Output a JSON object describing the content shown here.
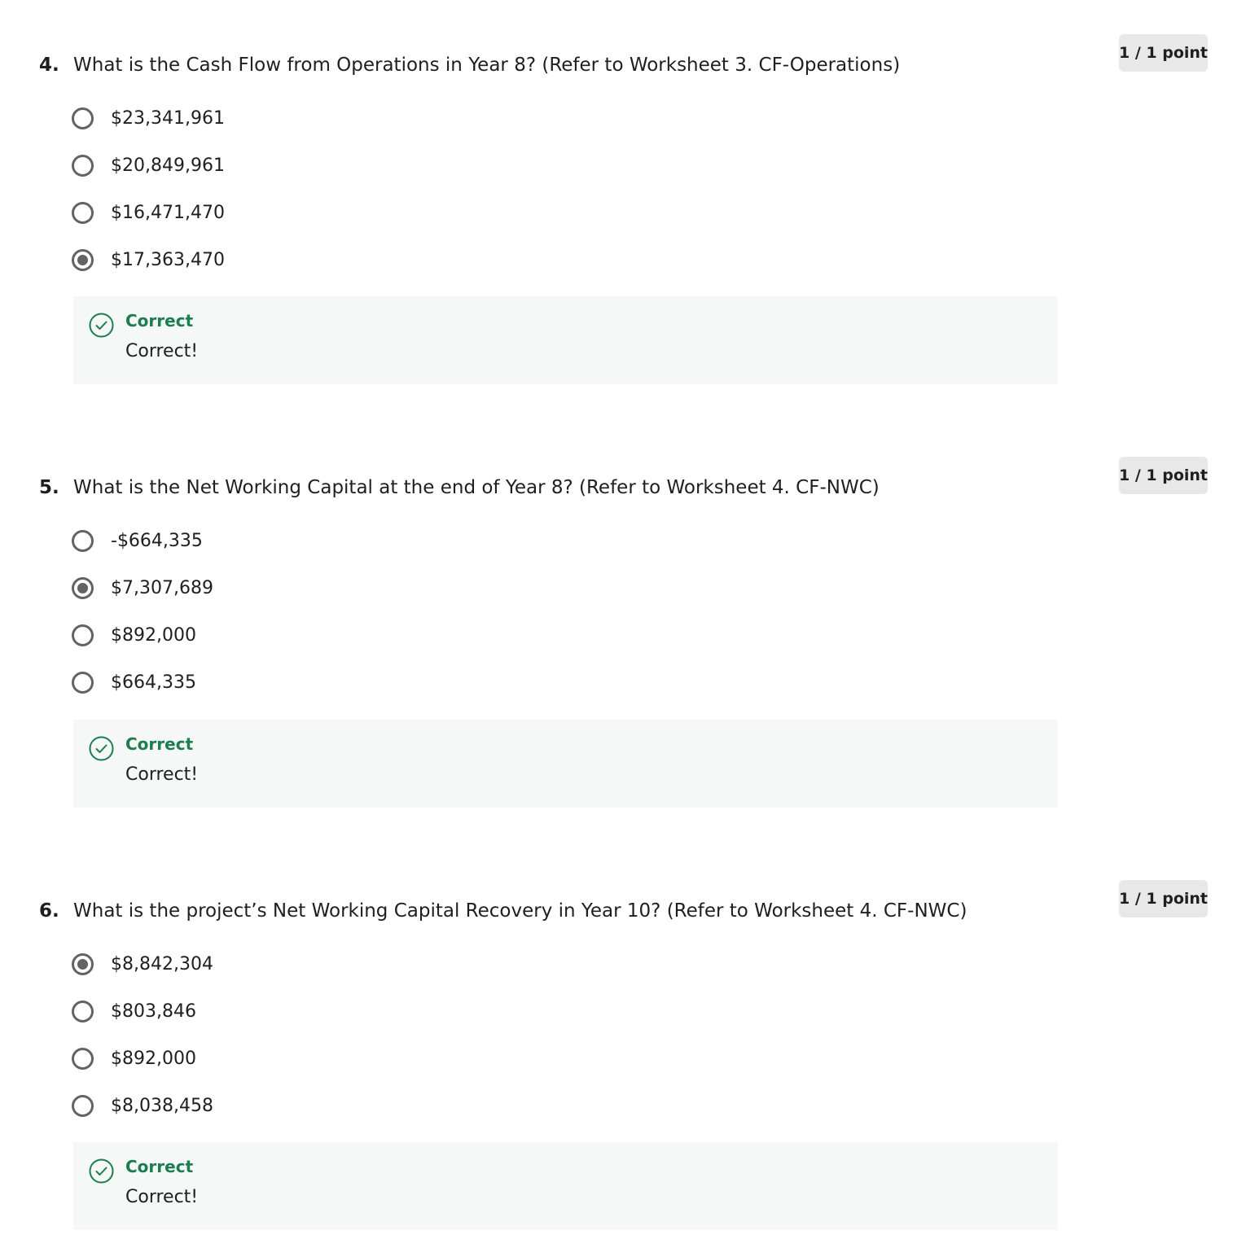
{
  "questions": [
    {
      "number": "4.",
      "text": "What is the Cash Flow from Operations in Year 8? (Refer to Worksheet 3. CF-Operations)",
      "points": "1 / 1 point",
      "options": [
        {
          "label": "$23,341,961",
          "selected": false
        },
        {
          "label": "$20,849,961",
          "selected": false
        },
        {
          "label": "$16,471,470",
          "selected": false
        },
        {
          "label": "$17,363,470",
          "selected": true
        }
      ],
      "feedback": {
        "title": "Correct",
        "text": "Correct!",
        "icon": "check-circle-icon"
      }
    },
    {
      "number": "5.",
      "text": "What is the Net Working Capital at the end of Year 8? (Refer to Worksheet 4. CF-NWC)",
      "points": "1 / 1 point",
      "options": [
        {
          "label": "-$664,335",
          "selected": false
        },
        {
          "label": "$7,307,689",
          "selected": true
        },
        {
          "label": "$892,000",
          "selected": false
        },
        {
          "label": "$664,335",
          "selected": false
        }
      ],
      "feedback": {
        "title": "Correct",
        "text": "Correct!",
        "icon": "check-circle-icon"
      }
    },
    {
      "number": "6.",
      "text": "What is the project’s Net Working Capital Recovery in Year 10? (Refer to Worksheet 4. CF-NWC)",
      "points": "1 / 1 point",
      "options": [
        {
          "label": "$8,842,304",
          "selected": true
        },
        {
          "label": "$803,846",
          "selected": false
        },
        {
          "label": "$892,000",
          "selected": false
        },
        {
          "label": "$8,038,458",
          "selected": false
        }
      ],
      "feedback": {
        "title": "Correct",
        "text": "Correct!",
        "icon": "check-circle-icon"
      }
    }
  ],
  "colors": {
    "correct_green": "#1c7e4e",
    "feedback_bg": "#f5f8f7",
    "points_badge_bg": "#e8e8e8",
    "radio_gray": "#636363",
    "text": "#1f1f1f"
  }
}
